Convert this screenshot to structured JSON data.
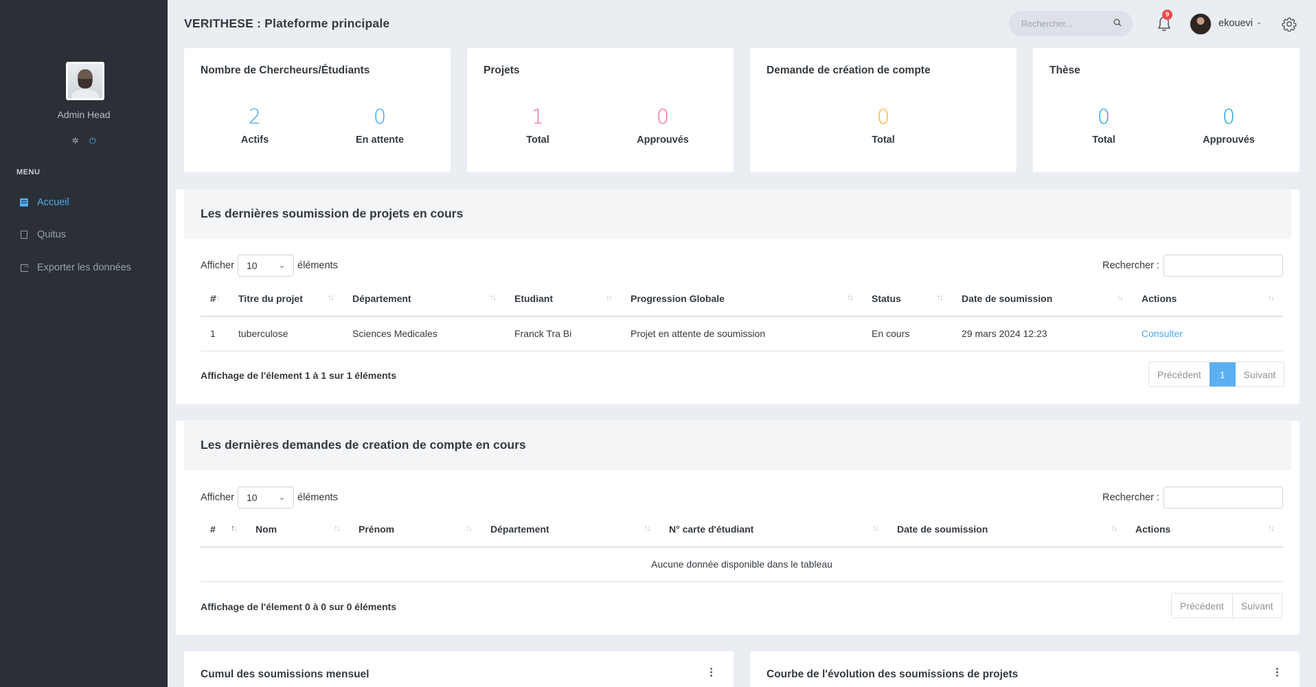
{
  "sidebar": {
    "admin_name": "Admin Head",
    "menu_title": "MENU",
    "items": [
      {
        "label": "Accueil",
        "icon": "dashboard-icon",
        "active": true
      },
      {
        "label": "Quitus",
        "icon": "document-icon",
        "active": false
      },
      {
        "label": "Exporter les données",
        "icon": "export-icon",
        "active": false
      }
    ]
  },
  "header": {
    "title": "VERITHESE : Plateforme principale",
    "search_placeholder": "Rechercher...",
    "notification_count": "9",
    "username": "ekouevi"
  },
  "stats": [
    {
      "title": "Nombre de Chercheurs/Étudiants",
      "values": [
        {
          "num": "2",
          "label": "Actifs",
          "color": "#3fa3e8"
        },
        {
          "num": "0",
          "label": "En attente",
          "color": "#3fa3e8"
        }
      ]
    },
    {
      "title": "Projets",
      "values": [
        {
          "num": "1",
          "label": "Total",
          "color": "#f06aa8"
        },
        {
          "num": "0",
          "label": "Approuvés",
          "color": "#f06aa8"
        }
      ]
    },
    {
      "title": "Demande de création de compte",
      "values": [
        {
          "num": "0",
          "label": "Total",
          "color": "#f7b23b"
        }
      ]
    },
    {
      "title": "Thèse",
      "values": [
        {
          "num": "0",
          "label": "Total",
          "color": "#1aa7d8"
        },
        {
          "num": "0",
          "label": "Approuvés",
          "color": "#1aa7d8"
        }
      ]
    }
  ],
  "projects_table": {
    "title": "Les dernières soumission de projets en cours",
    "afficher": "Afficher",
    "page_size": "10",
    "elements": "éléments",
    "search_label": "Rechercher :",
    "columns": [
      "#",
      "Titre du projet",
      "Département",
      "Etudiant",
      "Progression Globale",
      "Status",
      "Date de soumission",
      "Actions"
    ],
    "rows": [
      {
        "num": "1",
        "titre": "tuberculose",
        "departement": "Sciences Medicales",
        "etudiant": "Franck Tra Bi",
        "progression": "Projet en attente de soumission",
        "status": "En cours",
        "date": "29 mars 2024 12:23",
        "action": "Consulter"
      }
    ],
    "info": "Affichage de l'élement 1 à 1 sur 1 éléments",
    "prev": "Précédent",
    "page": "1",
    "next": "Suivant"
  },
  "accounts_table": {
    "title": "Les dernières demandes de creation de compte en cours",
    "afficher": "Afficher",
    "page_size": "10",
    "elements": "éléments",
    "search_label": "Rechercher :",
    "columns": [
      "#",
      "Nom",
      "Prénom",
      "Département",
      "N° carte d'étudiant",
      "Date de soumission",
      "Actions"
    ],
    "empty": "Aucune donnée disponible dans le tableau",
    "info": "Affichage de l'élement 0 à 0 sur 0 éléments",
    "prev": "Précédent",
    "next": "Suivant"
  },
  "charts": [
    {
      "title": "Cumul des soumissions mensuel"
    },
    {
      "title": "Courbe de l'évolution des soumissions de projets"
    }
  ],
  "colors": {
    "accent": "#4ea9ea",
    "sidebar": "#2a3036",
    "background": "#eaeef3",
    "badge": "#f04a4a"
  }
}
